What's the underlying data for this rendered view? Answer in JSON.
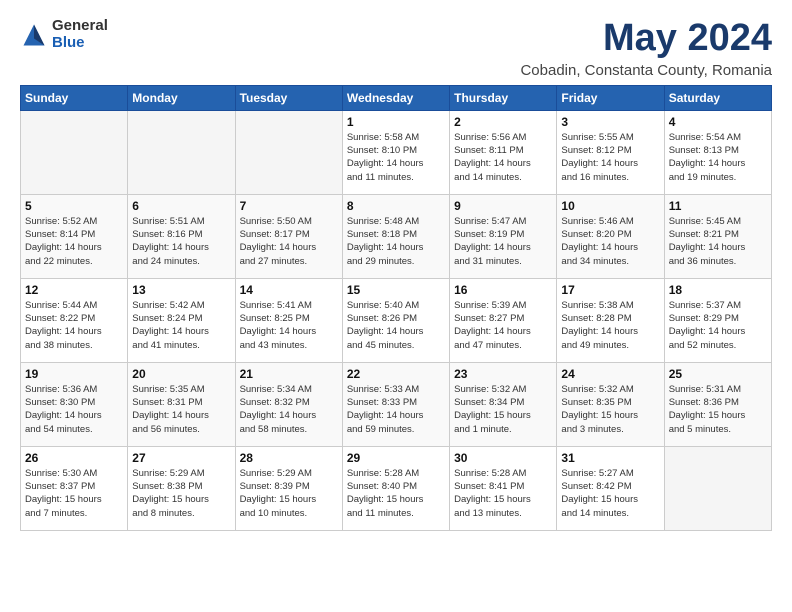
{
  "logo": {
    "general": "General",
    "blue": "Blue"
  },
  "title": "May 2024",
  "subtitle": "Cobadin, Constanta County, Romania",
  "days_of_week": [
    "Sunday",
    "Monday",
    "Tuesday",
    "Wednesday",
    "Thursday",
    "Friday",
    "Saturday"
  ],
  "weeks": [
    [
      {
        "num": "",
        "info": ""
      },
      {
        "num": "",
        "info": ""
      },
      {
        "num": "",
        "info": ""
      },
      {
        "num": "1",
        "info": "Sunrise: 5:58 AM\nSunset: 8:10 PM\nDaylight: 14 hours\nand 11 minutes."
      },
      {
        "num": "2",
        "info": "Sunrise: 5:56 AM\nSunset: 8:11 PM\nDaylight: 14 hours\nand 14 minutes."
      },
      {
        "num": "3",
        "info": "Sunrise: 5:55 AM\nSunset: 8:12 PM\nDaylight: 14 hours\nand 16 minutes."
      },
      {
        "num": "4",
        "info": "Sunrise: 5:54 AM\nSunset: 8:13 PM\nDaylight: 14 hours\nand 19 minutes."
      }
    ],
    [
      {
        "num": "5",
        "info": "Sunrise: 5:52 AM\nSunset: 8:14 PM\nDaylight: 14 hours\nand 22 minutes."
      },
      {
        "num": "6",
        "info": "Sunrise: 5:51 AM\nSunset: 8:16 PM\nDaylight: 14 hours\nand 24 minutes."
      },
      {
        "num": "7",
        "info": "Sunrise: 5:50 AM\nSunset: 8:17 PM\nDaylight: 14 hours\nand 27 minutes."
      },
      {
        "num": "8",
        "info": "Sunrise: 5:48 AM\nSunset: 8:18 PM\nDaylight: 14 hours\nand 29 minutes."
      },
      {
        "num": "9",
        "info": "Sunrise: 5:47 AM\nSunset: 8:19 PM\nDaylight: 14 hours\nand 31 minutes."
      },
      {
        "num": "10",
        "info": "Sunrise: 5:46 AM\nSunset: 8:20 PM\nDaylight: 14 hours\nand 34 minutes."
      },
      {
        "num": "11",
        "info": "Sunrise: 5:45 AM\nSunset: 8:21 PM\nDaylight: 14 hours\nand 36 minutes."
      }
    ],
    [
      {
        "num": "12",
        "info": "Sunrise: 5:44 AM\nSunset: 8:22 PM\nDaylight: 14 hours\nand 38 minutes."
      },
      {
        "num": "13",
        "info": "Sunrise: 5:42 AM\nSunset: 8:24 PM\nDaylight: 14 hours\nand 41 minutes."
      },
      {
        "num": "14",
        "info": "Sunrise: 5:41 AM\nSunset: 8:25 PM\nDaylight: 14 hours\nand 43 minutes."
      },
      {
        "num": "15",
        "info": "Sunrise: 5:40 AM\nSunset: 8:26 PM\nDaylight: 14 hours\nand 45 minutes."
      },
      {
        "num": "16",
        "info": "Sunrise: 5:39 AM\nSunset: 8:27 PM\nDaylight: 14 hours\nand 47 minutes."
      },
      {
        "num": "17",
        "info": "Sunrise: 5:38 AM\nSunset: 8:28 PM\nDaylight: 14 hours\nand 49 minutes."
      },
      {
        "num": "18",
        "info": "Sunrise: 5:37 AM\nSunset: 8:29 PM\nDaylight: 14 hours\nand 52 minutes."
      }
    ],
    [
      {
        "num": "19",
        "info": "Sunrise: 5:36 AM\nSunset: 8:30 PM\nDaylight: 14 hours\nand 54 minutes."
      },
      {
        "num": "20",
        "info": "Sunrise: 5:35 AM\nSunset: 8:31 PM\nDaylight: 14 hours\nand 56 minutes."
      },
      {
        "num": "21",
        "info": "Sunrise: 5:34 AM\nSunset: 8:32 PM\nDaylight: 14 hours\nand 58 minutes."
      },
      {
        "num": "22",
        "info": "Sunrise: 5:33 AM\nSunset: 8:33 PM\nDaylight: 14 hours\nand 59 minutes."
      },
      {
        "num": "23",
        "info": "Sunrise: 5:32 AM\nSunset: 8:34 PM\nDaylight: 15 hours\nand 1 minute."
      },
      {
        "num": "24",
        "info": "Sunrise: 5:32 AM\nSunset: 8:35 PM\nDaylight: 15 hours\nand 3 minutes."
      },
      {
        "num": "25",
        "info": "Sunrise: 5:31 AM\nSunset: 8:36 PM\nDaylight: 15 hours\nand 5 minutes."
      }
    ],
    [
      {
        "num": "26",
        "info": "Sunrise: 5:30 AM\nSunset: 8:37 PM\nDaylight: 15 hours\nand 7 minutes."
      },
      {
        "num": "27",
        "info": "Sunrise: 5:29 AM\nSunset: 8:38 PM\nDaylight: 15 hours\nand 8 minutes."
      },
      {
        "num": "28",
        "info": "Sunrise: 5:29 AM\nSunset: 8:39 PM\nDaylight: 15 hours\nand 10 minutes."
      },
      {
        "num": "29",
        "info": "Sunrise: 5:28 AM\nSunset: 8:40 PM\nDaylight: 15 hours\nand 11 minutes."
      },
      {
        "num": "30",
        "info": "Sunrise: 5:28 AM\nSunset: 8:41 PM\nDaylight: 15 hours\nand 13 minutes."
      },
      {
        "num": "31",
        "info": "Sunrise: 5:27 AM\nSunset: 8:42 PM\nDaylight: 15 hours\nand 14 minutes."
      },
      {
        "num": "",
        "info": ""
      }
    ]
  ]
}
